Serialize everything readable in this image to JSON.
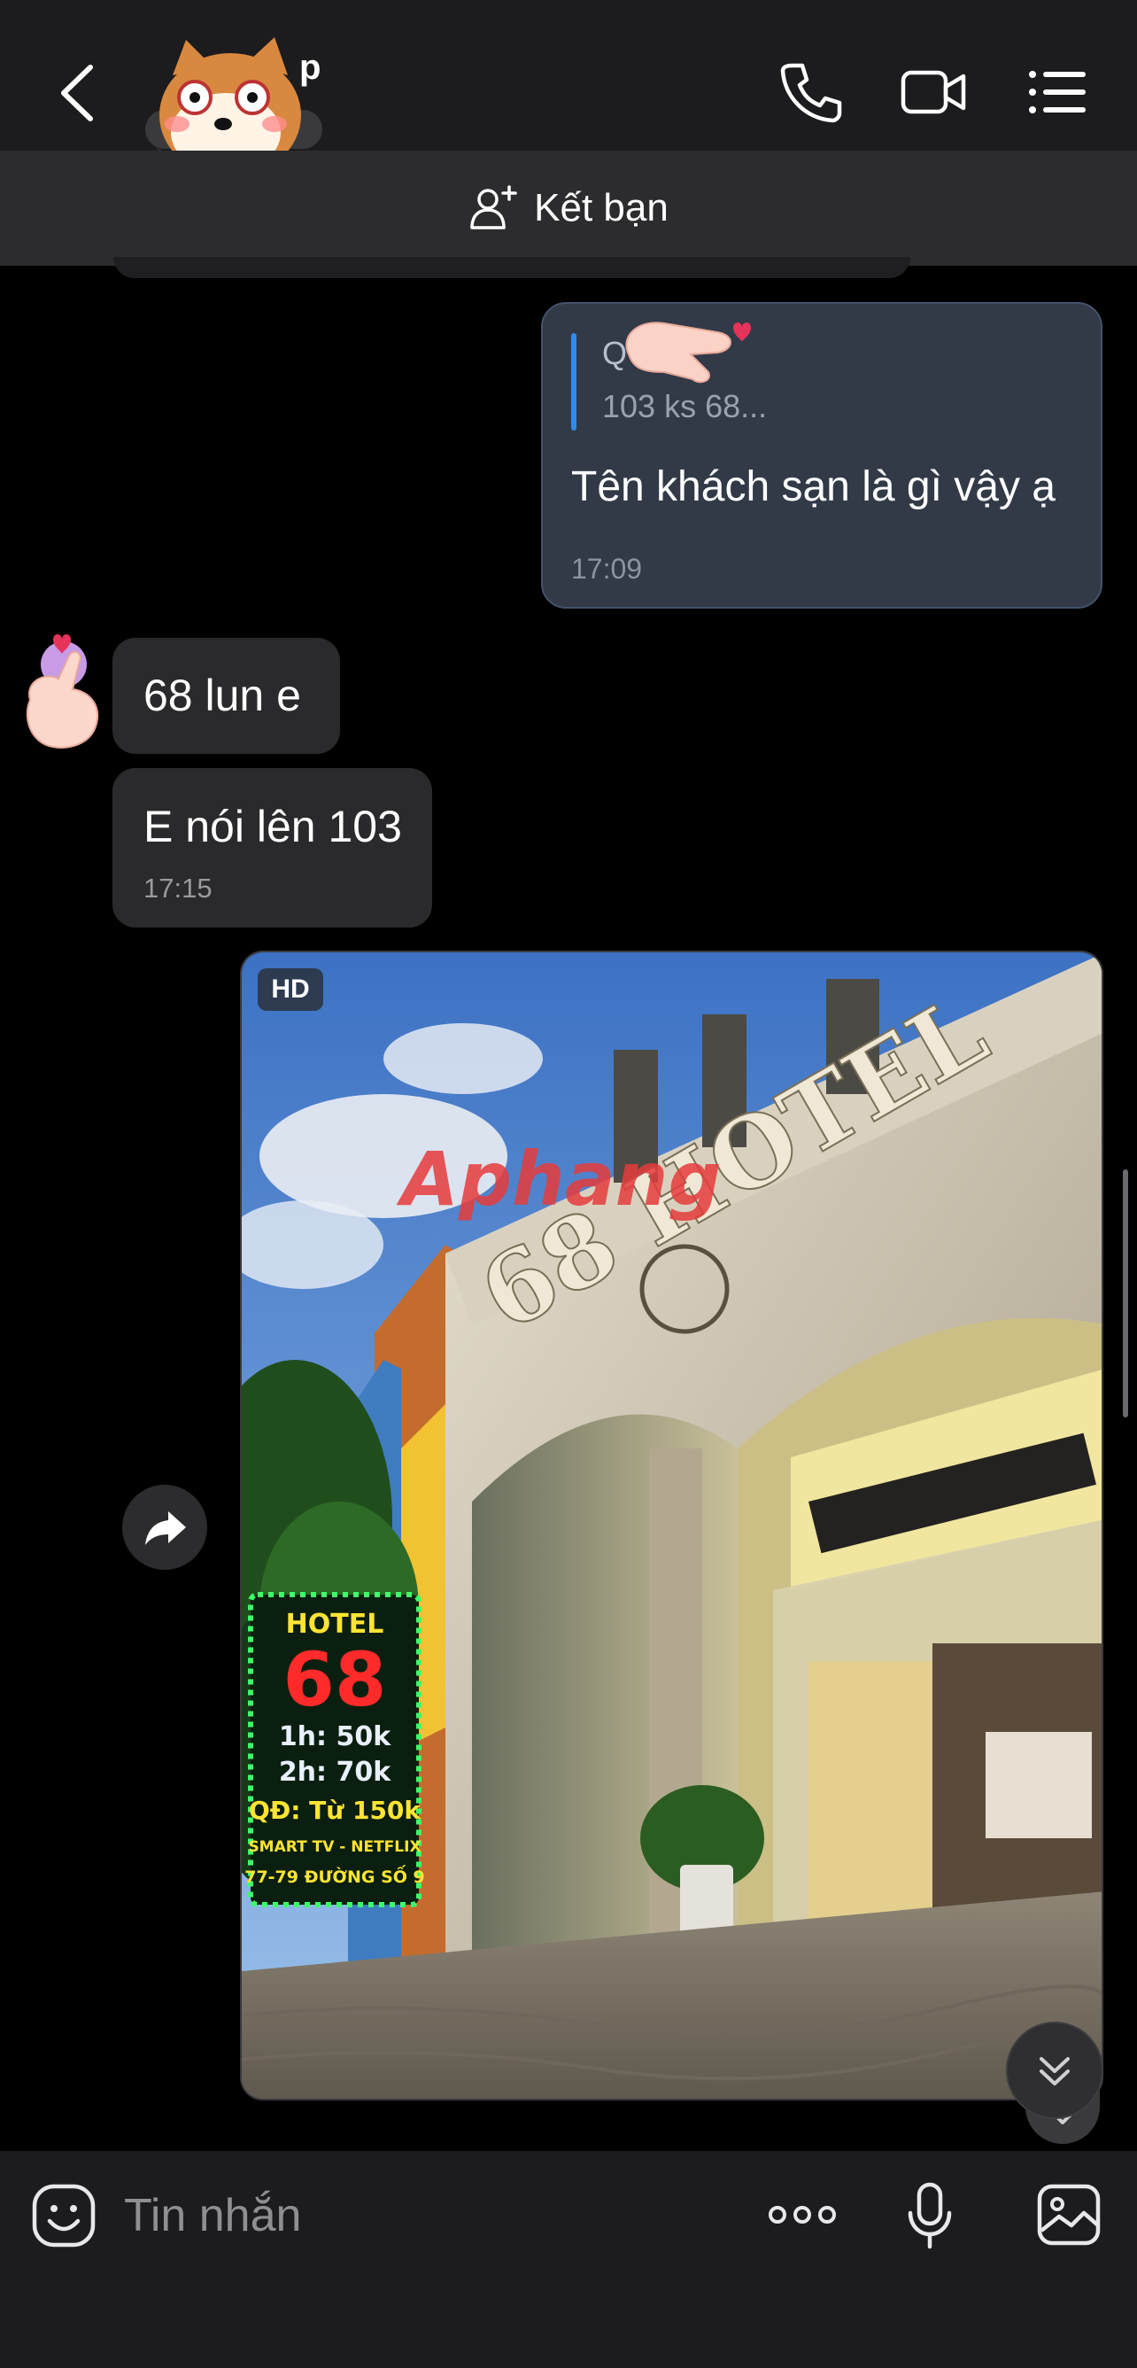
{
  "header": {
    "title_visible": "p",
    "add_friend_label": "Kết bạn",
    "icons": [
      "back-chevron-icon",
      "phone-icon",
      "video-call-icon",
      "list-menu-icon"
    ]
  },
  "messages": {
    "outgoing_1": {
      "quote_name": "Q",
      "quote_preview": "103 ks 68...",
      "text": "Tên khách sạn là gì vậy ạ",
      "time": "17:09"
    },
    "incoming_1": {
      "text": "68 lun e"
    },
    "incoming_2": {
      "text": "E nói lên 103",
      "time": "17:15"
    },
    "photo": {
      "hd_label": "HD",
      "sign_title": "HOTEL",
      "sign_number": "68",
      "sign_lines": [
        "1h: 50k",
        "2h: 70k",
        "QĐ: Từ 150k",
        "SMART TV - NETFLIX",
        "77-79 ĐƯỜNG SỐ 9"
      ],
      "building_sign": "68 HOTEL",
      "watermark": "Aphang"
    }
  },
  "composer": {
    "placeholder": "Tin nhắn"
  },
  "colors": {
    "background": "#000000",
    "header": "#1c1c1e",
    "outgoing_bubble": "#323a48",
    "incoming_bubble": "#2a2a2c",
    "accent_quote": "#2d8cf0"
  }
}
